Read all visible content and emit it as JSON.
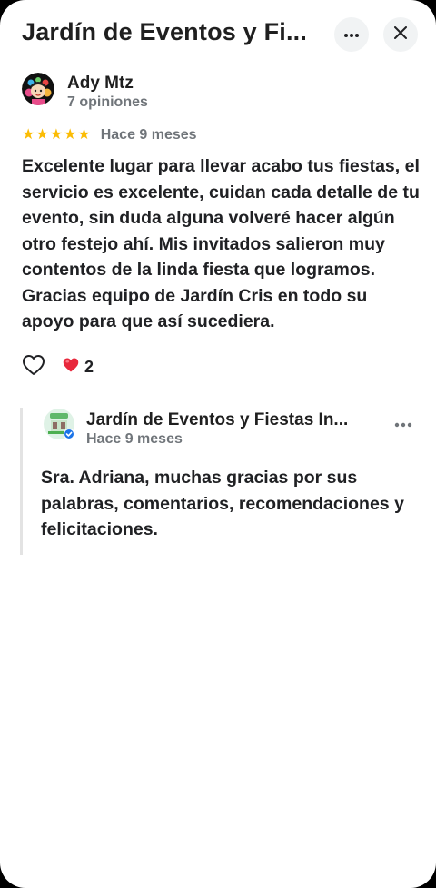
{
  "header": {
    "title": "Jardín de Eventos y Fi...",
    "more_icon": "more-horizontal-icon",
    "close_icon": "close-icon"
  },
  "review": {
    "reviewer_name": "Ady Mtz",
    "reviewer_reviews": "7 opiniones",
    "rating": 5,
    "stars": [
      "★",
      "★",
      "★",
      "★",
      "★"
    ],
    "time": "Hace 9 meses",
    "text": "Excelente lugar para llevar acabo tus fiestas, el servicio es excelente, cuidan cada detalle de tu evento, sin duda alguna volveré hacer algún otro festejo ahí. Mis invitados salieron muy contentos de la linda fiesta que logramos. Gracias equipo de Jardín Cris en todo su apoyo para que así sucediera.",
    "like_icon": "heart-outline-icon",
    "reaction_icon": "red-heart-icon",
    "reaction_count": "2"
  },
  "owner_reply": {
    "name": "Jardín de Eventos y Fiestas In...",
    "time": "Hace 9 meses",
    "text": "Sra. Adriana, muchas gracias por sus palabras, comentarios, recomendaciones y felicitaciones."
  },
  "colors": {
    "star": "#fbbc04",
    "heart": "#e8283c",
    "verified": "#1a73e8",
    "secondary_text": "#70757a"
  }
}
